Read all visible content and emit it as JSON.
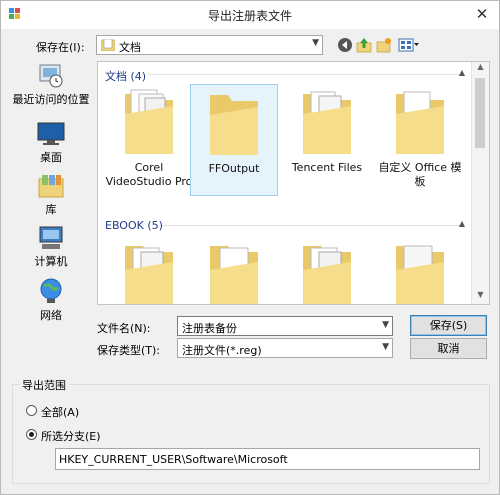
{
  "window": {
    "title": "导出注册表文件",
    "close_glyph": "✕"
  },
  "lookin": {
    "label": "保存在(I):",
    "value": "文档"
  },
  "toolbar": {
    "icons": [
      "back-icon",
      "up-folder-icon",
      "new-folder-icon",
      "view-menu-icon"
    ]
  },
  "places": [
    {
      "label": "最近访问的位置",
      "icon": "recent-places-icon"
    },
    {
      "label": "桌面",
      "icon": "desktop-icon"
    },
    {
      "label": "库",
      "icon": "libraries-icon"
    },
    {
      "label": "计算机",
      "icon": "computer-icon"
    },
    {
      "label": "网络",
      "icon": "network-icon"
    }
  ],
  "groups": [
    {
      "header": "文档 (4)",
      "items": [
        {
          "label": "Corel VideoStudio Pro",
          "selected": false
        },
        {
          "label": "FFOutput",
          "selected": true
        },
        {
          "label": "Tencent Files",
          "selected": false
        },
        {
          "label": "自定义 Office 模板",
          "selected": false
        }
      ]
    },
    {
      "header": "EBOOK (5)",
      "items": [
        {
          "label": "",
          "selected": false
        },
        {
          "label": "",
          "selected": false
        },
        {
          "label": "",
          "selected": false
        },
        {
          "label": "",
          "selected": false
        }
      ]
    }
  ],
  "filename": {
    "label": "文件名(N):",
    "value": "注册表备份"
  },
  "filetype": {
    "label": "保存类型(T):",
    "value": "注册文件(*.reg)"
  },
  "buttons": {
    "save": "保存(S)",
    "cancel": "取消"
  },
  "export_range": {
    "title": "导出范围",
    "all_label": "全部(A)",
    "branch_label": "所选分支(E)",
    "selected": "branch",
    "branch_value": "HKEY_CURRENT_USER\\Software\\Microsoft"
  },
  "colors": {
    "accent": "#1e3a8a",
    "selection": "#e5f3fb",
    "folder": "#f3d77e"
  }
}
